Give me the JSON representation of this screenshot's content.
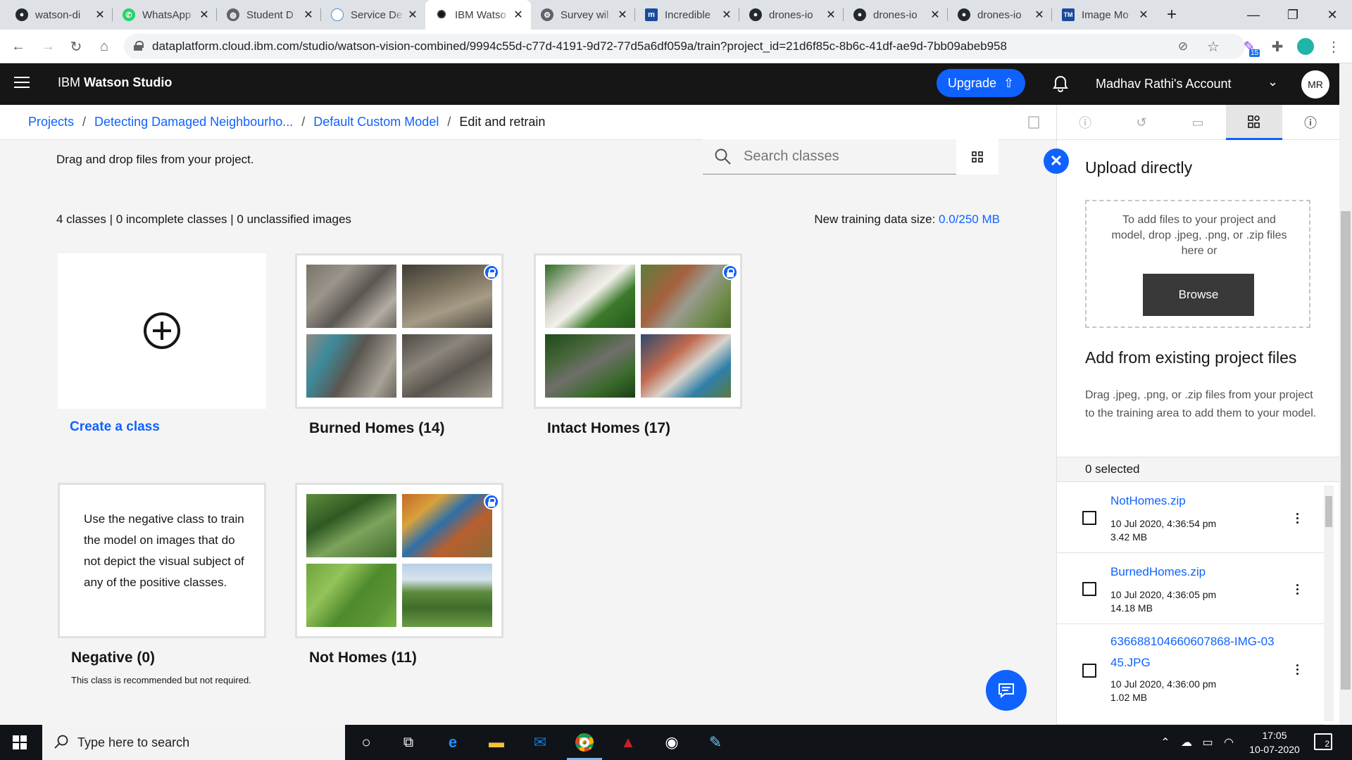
{
  "browser": {
    "tabs": [
      {
        "title": "watson-di",
        "icon": "github-icon",
        "color": "#24292e"
      },
      {
        "title": "WhatsApp",
        "icon": "whatsapp-icon",
        "color": "#25d366"
      },
      {
        "title": "Student D",
        "icon": "globe-icon",
        "color": "#5f6368"
      },
      {
        "title": "Service De",
        "icon": "cloud-icon",
        "color": "#4a90d9"
      },
      {
        "title": "IBM Watso",
        "icon": "watson-icon",
        "color": "#161616"
      },
      {
        "title": "Survey wil",
        "icon": "survey-icon",
        "color": "#5f6368"
      },
      {
        "title": "Incredible",
        "icon": "m-icon",
        "color": "#1a4a9b"
      },
      {
        "title": "drones-io",
        "icon": "github-icon",
        "color": "#24292e"
      },
      {
        "title": "drones-io",
        "icon": "github-icon",
        "color": "#24292e"
      },
      {
        "title": "drones-io",
        "icon": "github-icon",
        "color": "#24292e"
      },
      {
        "title": "Image Mo",
        "icon": "tm-icon",
        "color": "#1a4a9b"
      }
    ],
    "url": "dataplatform.cloud.ibm.com/studio/watson-vision-combined/9994c55d-c77d-4191-9d72-77d5a6df059a/train?project_id=21d6f85c-8b6c-41df-ae9d-7bb09abeb958",
    "extension_badge": "15"
  },
  "header": {
    "brand_prefix": "IBM",
    "brand_name": "Watson Studio",
    "upgrade_label": "Upgrade",
    "account_name": "Madhav Rathi's Account",
    "avatar_initials": "MR"
  },
  "breadcrumb": {
    "items": [
      "Projects",
      "Detecting Damaged Neighbourho...",
      "Default Custom Model"
    ],
    "current": "Edit and retrain"
  },
  "main": {
    "drag_hint": "Drag and drop files from your project.",
    "search_placeholder": "Search classes",
    "summary": "4 classes | 0 incomplete classes | 0 unclassified images",
    "training_size_label": "New training data size:",
    "training_size_value": "0.0/250 MB",
    "create_class_label": "Create a class",
    "classes": [
      {
        "title": "Burned Homes (14)",
        "locked": true
      },
      {
        "title": "Intact Homes (17)",
        "locked": true
      },
      {
        "title": "Not Homes (11)",
        "locked": true
      }
    ],
    "negative": {
      "title": "Negative (0)",
      "description": "Use the negative class to train the model on images that do not depict the visual subject of any of the positive classes.",
      "note": "This class is recommended but not required."
    }
  },
  "panel": {
    "upload_title": "Upload directly",
    "drop_text": "To add files to your project and model, drop .jpeg, .png, or .zip files here or",
    "browse_label": "Browse",
    "existing_title": "Add from existing project files",
    "existing_desc": "Drag .jpeg, .png, or .zip files from your project to the training area to add them to your model.",
    "selected_count": "0 selected",
    "files": [
      {
        "name": "NotHomes.zip",
        "date": "10 Jul 2020, 4:36:54 pm",
        "size": "3.42 MB"
      },
      {
        "name": "BurnedHomes.zip",
        "date": "10 Jul 2020, 4:36:05 pm",
        "size": "14.18 MB"
      },
      {
        "name": "636688104660607868-IMG-0345.JPG",
        "date": "10 Jul 2020, 4:36:00 pm",
        "size": "1.02 MB"
      }
    ]
  },
  "taskbar": {
    "search_placeholder": "Type here to search",
    "time": "17:05",
    "date": "10-07-2020",
    "notification_count": "2"
  },
  "colors": {
    "accent": "#0f62fe",
    "header_bg": "#161616"
  }
}
